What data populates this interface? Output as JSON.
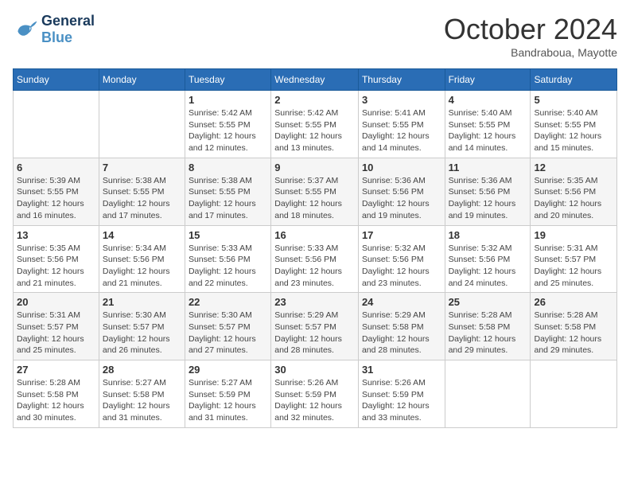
{
  "header": {
    "logo_line1": "General",
    "logo_line2": "Blue",
    "month": "October 2024",
    "location": "Bandraboua, Mayotte"
  },
  "weekdays": [
    "Sunday",
    "Monday",
    "Tuesday",
    "Wednesday",
    "Thursday",
    "Friday",
    "Saturday"
  ],
  "weeks": [
    [
      {
        "day": "",
        "info": ""
      },
      {
        "day": "",
        "info": ""
      },
      {
        "day": "1",
        "info": "Sunrise: 5:42 AM\nSunset: 5:55 PM\nDaylight: 12 hours and 12 minutes."
      },
      {
        "day": "2",
        "info": "Sunrise: 5:42 AM\nSunset: 5:55 PM\nDaylight: 12 hours and 13 minutes."
      },
      {
        "day": "3",
        "info": "Sunrise: 5:41 AM\nSunset: 5:55 PM\nDaylight: 12 hours and 14 minutes."
      },
      {
        "day": "4",
        "info": "Sunrise: 5:40 AM\nSunset: 5:55 PM\nDaylight: 12 hours and 14 minutes."
      },
      {
        "day": "5",
        "info": "Sunrise: 5:40 AM\nSunset: 5:55 PM\nDaylight: 12 hours and 15 minutes."
      }
    ],
    [
      {
        "day": "6",
        "info": "Sunrise: 5:39 AM\nSunset: 5:55 PM\nDaylight: 12 hours and 16 minutes."
      },
      {
        "day": "7",
        "info": "Sunrise: 5:38 AM\nSunset: 5:55 PM\nDaylight: 12 hours and 17 minutes."
      },
      {
        "day": "8",
        "info": "Sunrise: 5:38 AM\nSunset: 5:55 PM\nDaylight: 12 hours and 17 minutes."
      },
      {
        "day": "9",
        "info": "Sunrise: 5:37 AM\nSunset: 5:55 PM\nDaylight: 12 hours and 18 minutes."
      },
      {
        "day": "10",
        "info": "Sunrise: 5:36 AM\nSunset: 5:56 PM\nDaylight: 12 hours and 19 minutes."
      },
      {
        "day": "11",
        "info": "Sunrise: 5:36 AM\nSunset: 5:56 PM\nDaylight: 12 hours and 19 minutes."
      },
      {
        "day": "12",
        "info": "Sunrise: 5:35 AM\nSunset: 5:56 PM\nDaylight: 12 hours and 20 minutes."
      }
    ],
    [
      {
        "day": "13",
        "info": "Sunrise: 5:35 AM\nSunset: 5:56 PM\nDaylight: 12 hours and 21 minutes."
      },
      {
        "day": "14",
        "info": "Sunrise: 5:34 AM\nSunset: 5:56 PM\nDaylight: 12 hours and 21 minutes."
      },
      {
        "day": "15",
        "info": "Sunrise: 5:33 AM\nSunset: 5:56 PM\nDaylight: 12 hours and 22 minutes."
      },
      {
        "day": "16",
        "info": "Sunrise: 5:33 AM\nSunset: 5:56 PM\nDaylight: 12 hours and 23 minutes."
      },
      {
        "day": "17",
        "info": "Sunrise: 5:32 AM\nSunset: 5:56 PM\nDaylight: 12 hours and 23 minutes."
      },
      {
        "day": "18",
        "info": "Sunrise: 5:32 AM\nSunset: 5:56 PM\nDaylight: 12 hours and 24 minutes."
      },
      {
        "day": "19",
        "info": "Sunrise: 5:31 AM\nSunset: 5:57 PM\nDaylight: 12 hours and 25 minutes."
      }
    ],
    [
      {
        "day": "20",
        "info": "Sunrise: 5:31 AM\nSunset: 5:57 PM\nDaylight: 12 hours and 25 minutes."
      },
      {
        "day": "21",
        "info": "Sunrise: 5:30 AM\nSunset: 5:57 PM\nDaylight: 12 hours and 26 minutes."
      },
      {
        "day": "22",
        "info": "Sunrise: 5:30 AM\nSunset: 5:57 PM\nDaylight: 12 hours and 27 minutes."
      },
      {
        "day": "23",
        "info": "Sunrise: 5:29 AM\nSunset: 5:57 PM\nDaylight: 12 hours and 28 minutes."
      },
      {
        "day": "24",
        "info": "Sunrise: 5:29 AM\nSunset: 5:58 PM\nDaylight: 12 hours and 28 minutes."
      },
      {
        "day": "25",
        "info": "Sunrise: 5:28 AM\nSunset: 5:58 PM\nDaylight: 12 hours and 29 minutes."
      },
      {
        "day": "26",
        "info": "Sunrise: 5:28 AM\nSunset: 5:58 PM\nDaylight: 12 hours and 29 minutes."
      }
    ],
    [
      {
        "day": "27",
        "info": "Sunrise: 5:28 AM\nSunset: 5:58 PM\nDaylight: 12 hours and 30 minutes."
      },
      {
        "day": "28",
        "info": "Sunrise: 5:27 AM\nSunset: 5:58 PM\nDaylight: 12 hours and 31 minutes."
      },
      {
        "day": "29",
        "info": "Sunrise: 5:27 AM\nSunset: 5:59 PM\nDaylight: 12 hours and 31 minutes."
      },
      {
        "day": "30",
        "info": "Sunrise: 5:26 AM\nSunset: 5:59 PM\nDaylight: 12 hours and 32 minutes."
      },
      {
        "day": "31",
        "info": "Sunrise: 5:26 AM\nSunset: 5:59 PM\nDaylight: 12 hours and 33 minutes."
      },
      {
        "day": "",
        "info": ""
      },
      {
        "day": "",
        "info": ""
      }
    ]
  ]
}
